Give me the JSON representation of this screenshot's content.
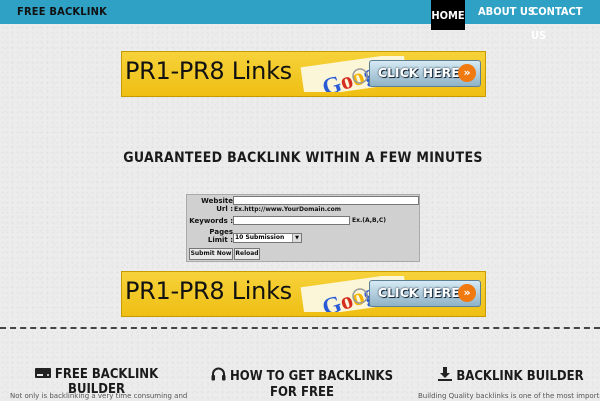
{
  "nav": {
    "brand": "FREE BACKLINK",
    "items": [
      {
        "label": "HOME",
        "active": true
      },
      {
        "label": "ABOUT US",
        "active": false
      },
      {
        "label": "CONTACT US",
        "active": false
      }
    ]
  },
  "banners": [
    {
      "text": "PR1-PR8 Links",
      "logo": "Google",
      "button": "CLICK HERE",
      "arrow": "»"
    },
    {
      "text": "PR1-PR8 Links",
      "logo": "Google",
      "button": "CLICK HERE",
      "arrow": "»"
    }
  ],
  "headline": "GUARANTEED BACKLINK WITHIN A FEW MINUTES",
  "form": {
    "website_label": "Website Url :",
    "website_value": "",
    "website_hint": "Ex.http://www.YourDomain.com",
    "keywords_label": "Keywords :",
    "keywords_value": "",
    "keywords_hint": "Ex.(A,B,C)",
    "pages_label": "Pages Limit :",
    "pages_selected": "10 Submission",
    "submit_label": "Submit Now",
    "reload_label": "Reload"
  },
  "features": [
    {
      "title": "FREE BACKLINK BUILDER",
      "icon": "hard-drive-icon",
      "desc": "Not only is backlinking a very time consuming and"
    },
    {
      "title": "HOW TO GET BACKLINKS FOR FREE",
      "icon": "headphones-icon",
      "desc": ""
    },
    {
      "title": "BACKLINK BUILDER",
      "icon": "download-icon",
      "desc": "Building Quality backlinks is one of the most important"
    }
  ],
  "colors": {
    "nav_bg": "#2ea1c4",
    "banner_bg": "#f2c82a",
    "click_arrow": "#f07a10"
  }
}
